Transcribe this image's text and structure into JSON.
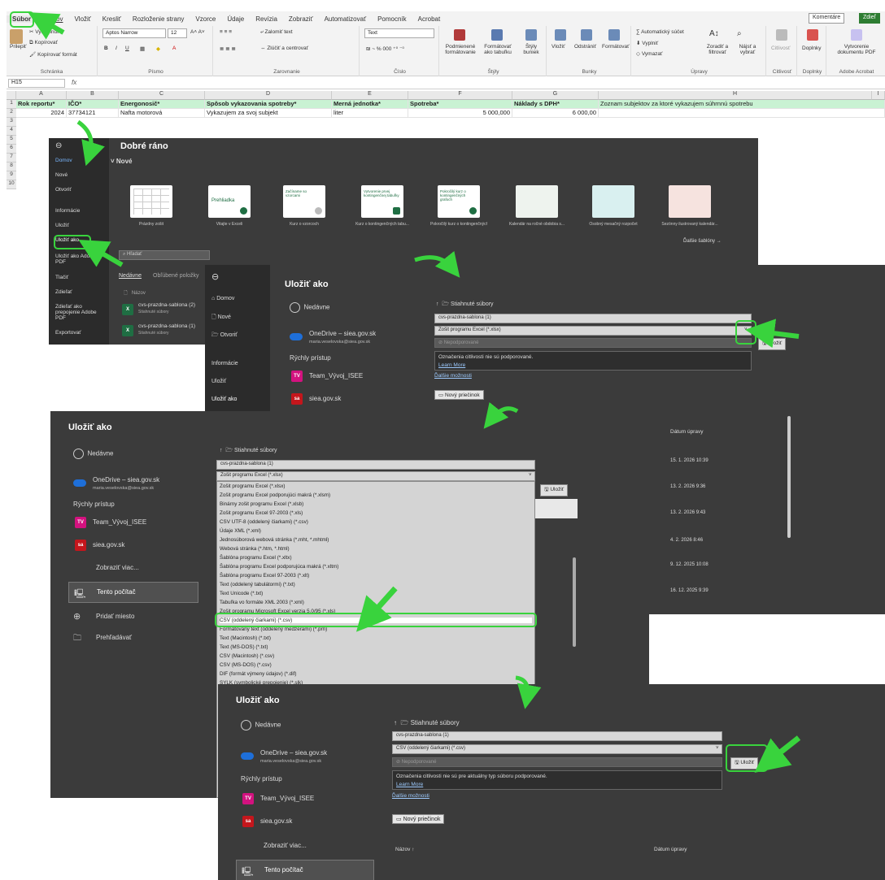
{
  "ribbon": {
    "tabs": [
      "Súbor",
      "Domov",
      "Vložiť",
      "Kresliť",
      "Rozloženie strany",
      "Vzorce",
      "Údaje",
      "Revízia",
      "Zobraziť",
      "Automatizovať",
      "Pomocník",
      "Acrobat"
    ],
    "comments_label": "Komentáre",
    "share_label": "Zdieľ",
    "clipboard": {
      "paste": "Prilepiť",
      "cut": "Vystrihnúť",
      "copy": "Kopírovať",
      "format": "Kopírovať formát",
      "group": "Schránka"
    },
    "font": {
      "name": "Aptos Narrow",
      "size": "12",
      "group": "Písmo"
    },
    "alignment": {
      "wrap": "Zalomiť text",
      "merge": "Zlúčiť a centrovať",
      "group": "Zarovnanie"
    },
    "number": {
      "format": "Text",
      "group": "Číslo"
    },
    "styles": {
      "cond": "Podmienené formátovanie",
      "table": "Formátovať ako tabuľku",
      "cell": "Štýly buniek",
      "group": "Štýly"
    },
    "cells": {
      "insert": "Vložiť",
      "delete": "Odstrániť",
      "format": "Formátovať",
      "group": "Bunky"
    },
    "editing": {
      "autosum": "Automatický súčet",
      "fill": "Vyplniť",
      "clear": "Vymazať",
      "sort": "Zoradiť a filtrovať",
      "find": "Nájsť a vybrať",
      "group": "Úpravy"
    },
    "sensitivity": {
      "label": "Citlivosť",
      "group": "Citlivosť"
    },
    "addins": {
      "label": "Doplnky",
      "group": "Doplnky"
    },
    "acrobat": {
      "label": "Vytvorenie dokumentu PDF",
      "group": "Adobe Acrobat"
    }
  },
  "formula_bar": {
    "name_box": "H15",
    "fx": "fx"
  },
  "sheet": {
    "columns": [
      "A",
      "B",
      "C",
      "D",
      "E",
      "F",
      "G",
      "H",
      "I"
    ],
    "rows": [
      "1",
      "2",
      "3",
      "4",
      "5",
      "6",
      "7",
      "8",
      "9",
      "10"
    ],
    "header": [
      "Rok reportu*",
      "IČO*",
      "Energonosič*",
      "Spôsob vykazovania spotreby*",
      "Merná jednotka*",
      "Spotreba*",
      "Náklady s DPH*",
      "Zoznam subjektov za ktoré vykazujem súhrnnú spotrebu"
    ],
    "data": [
      "2024",
      "37734121",
      "Nafta motorová",
      "Vykazujem za svoj subjekt",
      "liter",
      "5 000,000",
      "6 000,00",
      ""
    ]
  },
  "backstage_home": {
    "nav": [
      "Domov",
      "Nové",
      "Otvoriť",
      "Informácie",
      "Uložiť",
      "Uložiť ako",
      "Uložiť ako Adobe PDF",
      "Tlačiť",
      "Zdieľať",
      "Zdieľať ako prepojenie Adobe PDF",
      "Exportovať"
    ],
    "title": "Dobré ráno",
    "new_label": "Nové",
    "templates": [
      "Prázdny zošit",
      "Vitajte v Exceli",
      "Kurz o vzorcoch",
      "Kurz o kontingenčných tabu...",
      "Pokročilý kurz o kontingenčných...",
      "Kalendár na ročné obdobia s...",
      "Osobný mesačný rozpočet",
      "Sezónny ilustrovaný kalendár..."
    ],
    "template_texts": [
      "Prehliadka",
      "Začíname so vzorcami",
      "Vytvorenie prvej kontingenčnej tabuľky",
      "Pokročilý kurz o kontingenčných grafoch"
    ],
    "more_templates": "Ďalšie šablóny →",
    "search_placeholder": "Hľadať",
    "recent_tabs": [
      "Nedávne",
      "Obľúbené položky"
    ],
    "name_col": "Názov",
    "recent_files": [
      {
        "name": "cvs-prazdna-sablona (2)",
        "loc": "Stiahnuté súbory"
      },
      {
        "name": "cvs-prazdna-sablona (1)",
        "loc": "Stiahnuté súbory"
      }
    ]
  },
  "saveas1": {
    "nav": [
      "Domov",
      "Nové",
      "Otvoriť",
      "Informácie",
      "Uložiť",
      "Uložiť ako"
    ],
    "title": "Uložiť ako",
    "recent": "Nedávne",
    "onedrive": "OneDrive – siea.gov.sk",
    "email": "maria.veselovska@siea.gov.sk",
    "quick_access": "Rýchly prístup",
    "team": "Team_Vývoj_ISEE",
    "siea": "siea.gov.sk",
    "path": "Stiahnuté súbory",
    "filename": "cvs-prazdna-sablona (1)",
    "filetype": "Zošit programu Excel (*.xlsx)",
    "sensitivity": "Nepodporované",
    "save_btn": "Uložiť",
    "note": "Označenia citlivosti nie sú podporované.",
    "learn": "Learn More",
    "more": "Ďalšie možnosti",
    "new_folder": "Nový priečinok"
  },
  "saveas2": {
    "title": "Uložiť ako",
    "recent": "Nedávne",
    "onedrive": "OneDrive – siea.gov.sk",
    "email": "maria.veselovska@siea.gov.sk",
    "quick_access": "Rýchly prístup",
    "team": "Team_Vývoj_ISEE",
    "siea": "siea.gov.sk",
    "more_view": "Zobraziť viac...",
    "this_pc": "Tento počítač",
    "add_place": "Pridať miesto",
    "browse": "Prehľadávať",
    "path": "Stiahnuté súbory",
    "filename": "cvs-prazdna-sablona (1)",
    "filetype": "Zošit programu Excel (*.xlsx)",
    "save_btn": "Uložiť",
    "date_header": "Dátum úpravy",
    "dates": [
      "15. 1. 2026 10:39",
      "13. 2. 2026 9:36",
      "13. 2. 2026 9:43",
      "4. 2. 2026 8:46",
      "9. 12. 2025 10:08",
      "16. 12. 2025 9:39"
    ],
    "types": [
      "Zošit programu Excel (*.xlsx)",
      "Zošit programu Excel podporujúci makrá (*.xlsm)",
      "Binárny zošit programu Excel (*.xlsb)",
      "Zošit programu Excel 97-2003 (*.xls)",
      "CSV UTF-8 (oddelený čiarkami) (*.csv)",
      "Údaje XML (*.xml)",
      "Jednosúborová webová stránka (*.mht, *.mhtml)",
      "Webová stránka (*.htm, *.html)",
      "Šablóna programu Excel (*.xltx)",
      "Šablóna programu Excel podporujúca makrá (*.xltm)",
      "Šablóna programu Excel 97-2003 (*.xlt)",
      "Text (oddelený tabulátormi) (*.txt)",
      "Text Unicode (*.txt)",
      "Tabuľka vo formáte XML 2003 (*.xml)",
      "Zošit programu Microsoft Excel verzia 5.0/95 (*.xls)",
      "CSV (oddelený čiarkami) (*.csv)",
      "Formátovaný text (oddelený medzerami) (*.prn)",
      "Text (Macintosh) (*.txt)",
      "Text (MS-DOS) (*.txt)",
      "CSV (Macintosh) (*.csv)",
      "CSV (MS-DOS) (*.csv)",
      "DIF (formát výmeny údajov) (*.dif)",
      "SYLK (symbolické prepojenie) (*.slk)"
    ]
  },
  "saveas3": {
    "title": "Uložiť ako",
    "recent": "Nedávne",
    "onedrive": "OneDrive – siea.gov.sk",
    "email": "maria.veselovska@siea.gov.sk",
    "quick_access": "Rýchly prístup",
    "team": "Team_Vývoj_ISEE",
    "siea": "siea.gov.sk",
    "more_view": "Zobraziť viac...",
    "this_pc": "Tento počítač",
    "path": "Stiahnuté súbory",
    "filename": "cvs-prazdna-sablona (1)",
    "filetype": "CSV (oddelený čiarkami) (*.csv)",
    "sensitivity": "Nepodporované",
    "save_btn": "Uložiť",
    "note": "Označenia citlivosti nie sú pre aktuálny typ súboru podporované.",
    "learn": "Learn More",
    "more": "Ďalšie možnosti",
    "new_folder": "Nový priečinok",
    "name_col": "Názov ↑",
    "date_col": "Dátum úpravy"
  },
  "colors": {
    "highlight": "#39d33d",
    "header_fill": "#c9f2d3",
    "dark_bg": "#3b3b3b",
    "nav_bg": "#2b2b2b",
    "team_tile": "#d3127f",
    "siea_tile": "#c4161c"
  }
}
